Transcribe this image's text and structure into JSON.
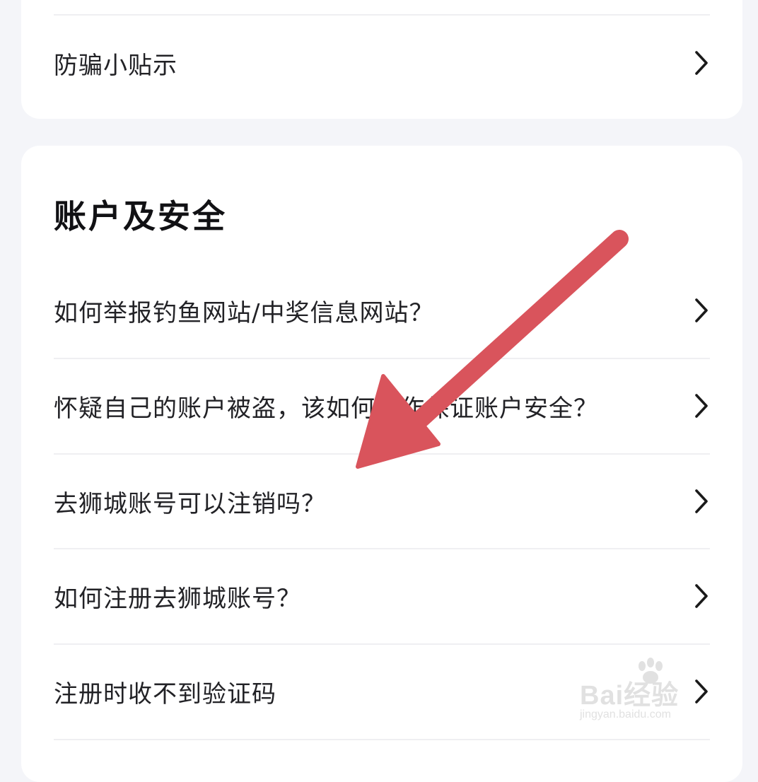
{
  "top_card": {
    "item_label": "防骗小贴示"
  },
  "section": {
    "title": "账户及安全",
    "items": [
      {
        "label": "如何举报钓鱼网站/中奖信息网站？"
      },
      {
        "label": "怀疑自己的账户被盗，该如何操作保证账户安全？"
      },
      {
        "label": "去狮城账号可以注销吗？"
      },
      {
        "label": "如何注册去狮城账号？"
      },
      {
        "label": "注册时收不到验证码"
      }
    ]
  },
  "overlay": {
    "arrow_color": "#d9545c"
  },
  "watermark": {
    "brand": "Bai经验",
    "url": "jingyan.baidu.com"
  },
  "icons": {
    "row_chevron": "chevron-right-icon",
    "watermark_paw": "paw-icon"
  }
}
